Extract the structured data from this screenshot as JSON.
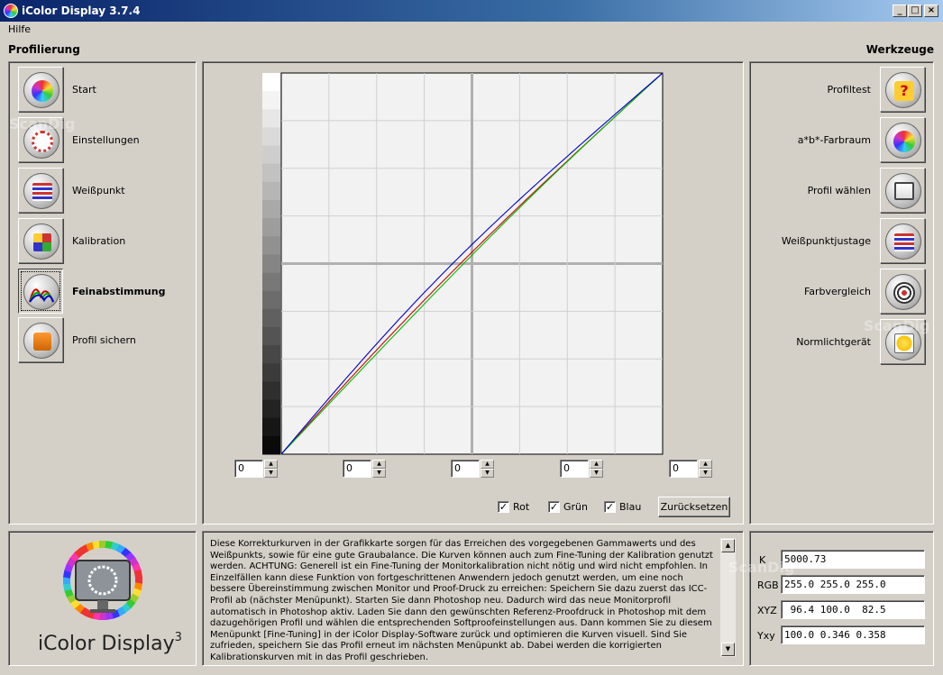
{
  "window": {
    "title": "iColor Display 3.7.4"
  },
  "menu": {
    "help": "Hilfe"
  },
  "left": {
    "title": "Profilierung",
    "items": [
      {
        "label": "Start",
        "icon": "color-wheel-icon"
      },
      {
        "label": "Einstellungen",
        "icon": "settings-dial-icon"
      },
      {
        "label": "Weißpunkt",
        "icon": "whitepoint-icon"
      },
      {
        "label": "Kalibration",
        "icon": "calibration-grid-icon"
      },
      {
        "label": "Feinabstimmung",
        "icon": "curves-icon",
        "active": true
      },
      {
        "label": "Profil sichern",
        "icon": "save-profile-icon"
      }
    ]
  },
  "right": {
    "title": "Werkzeuge",
    "items": [
      {
        "label": "Profiltest",
        "icon": "question-icon"
      },
      {
        "label": "a*b*-Farbraum",
        "icon": "gamut-icon"
      },
      {
        "label": "Profil wählen",
        "icon": "select-profile-icon"
      },
      {
        "label": "Weißpunktjustage",
        "icon": "whitepoint-adjust-icon"
      },
      {
        "label": "Farbvergleich",
        "icon": "target-icon"
      },
      {
        "label": "Normlichtgerät",
        "icon": "lightbulb-icon"
      }
    ]
  },
  "curves": {
    "spinners": [
      "0",
      "0",
      "0",
      "0",
      "0"
    ],
    "checkboxes": [
      {
        "label": "Rot",
        "checked": true
      },
      {
        "label": "Grün",
        "checked": true
      },
      {
        "label": "Blau",
        "checked": true
      }
    ],
    "reset_label": "Zurücksetzen",
    "colors": {
      "red": "#cc0000",
      "green": "#00bb00",
      "blue": "#0000cc"
    }
  },
  "description": "Diese Korrekturkurven in der Grafikkarte sorgen für das Erreichen des vorgegebenen Gammawerts und des Weißpunkts, sowie für eine gute Graubalance. Die Kurven können auch zum Fine-Tuning der Kalibration genutzt werden. ACHTUNG: Generell ist ein Fine-Tuning der Monitorkalibration nicht nötig und wird nicht empfohlen. In Einzelfällen kann diese Funktion von fortgeschrittenen Anwendern jedoch genutzt werden, um eine noch bessere Übereinstimmung zwischen Monitor und Proof-Druck zu erreichen: Speichern Sie dazu zuerst das ICC-Profil ab (nächster Menüpunkt). Starten Sie dann Photoshop neu. Dadurch wird das neue Monitorprofil automatisch in Photoshop aktiv. Laden Sie dann den gewünschten Referenz-Proofdruck in Photoshop mit dem dazugehörigen Profil und wählen die entsprechenden Softproofeinstellungen aus. Dann kommen Sie zu diesem Menüpunkt [Fine-Tuning] in der iColor Display-Software zurück und optimieren die Kurven visuell. Sind Sie zufrieden, speichern Sie das Profil erneut im nächsten Menüpunkt ab. Dabei werden die korrigierten Kalibrationskurven mit in das Profil geschrieben.",
  "values": [
    {
      "label": "K",
      "value": "5000.73"
    },
    {
      "label": "RGB",
      "value": "255.0 255.0 255.0"
    },
    {
      "label": "XYZ",
      "value": " 96.4 100.0  82.5"
    },
    {
      "label": "Yxy",
      "value": "100.0 0.346 0.358"
    }
  ],
  "logo": {
    "name": "iColor Display",
    "superscript": "3"
  },
  "watermark": "ScanDig"
}
